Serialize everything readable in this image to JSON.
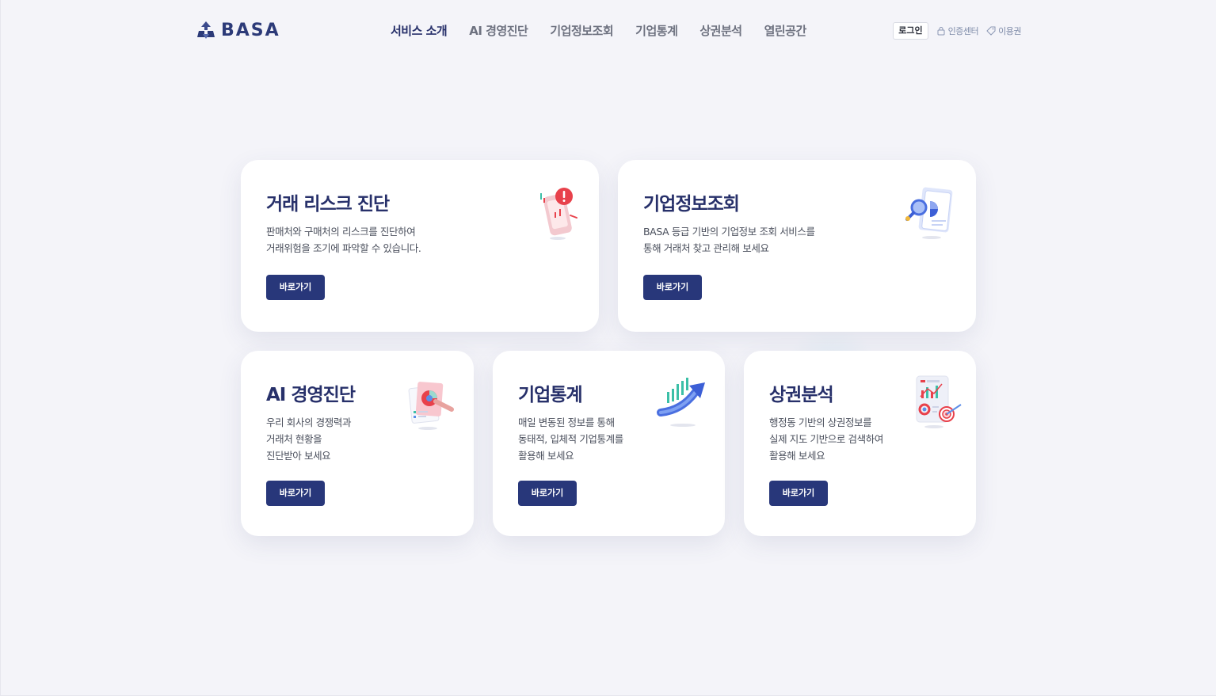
{
  "header": {
    "logo_text": "BASA",
    "nav": [
      {
        "label": "서비스 소개",
        "active": true
      },
      {
        "label": "AI 경영진단",
        "active": false
      },
      {
        "label": "기업정보조회",
        "active": false
      },
      {
        "label": "기업통계",
        "active": false
      },
      {
        "label": "상권분석",
        "active": false
      },
      {
        "label": "열린공간",
        "active": false
      }
    ],
    "login_label": "로그인",
    "cert_label": "인증센터",
    "voucher_label": "이용권"
  },
  "cards": {
    "risk": {
      "title": "거래 리스크 진단",
      "desc": [
        "판매처와 구매처의 리스크를 진단하여",
        "거래위험을 조기에 파악할 수 있습니다."
      ],
      "button": "바로가기",
      "icon": "risk-alert-phone-icon"
    },
    "info": {
      "title": "기업정보조회",
      "desc": [
        "BASA 등급 기반의 기업정보 조회 서비스를",
        "통해 거래처 찾고 관리해 보세요"
      ],
      "button": "바로가기",
      "icon": "document-search-icon"
    },
    "ai": {
      "title": "AI 경영진단",
      "desc": [
        "우리 회사의 경쟁력과",
        "거래처 현황을",
        "진단받아 보세요"
      ],
      "button": "바로가기",
      "icon": "report-chart-icon"
    },
    "stats": {
      "title": "기업통계",
      "desc": [
        "매일 변동된 정보를 통해",
        "동태적, 입체적 기업통계를",
        "활용해 보세요"
      ],
      "button": "바로가기",
      "icon": "growth-arrow-chart-icon"
    },
    "market": {
      "title": "상권분석",
      "desc": [
        "행정동 기반의 상권정보를",
        "실제 지도 기반으로 검색하여",
        "활용해 보세요"
      ],
      "button": "바로가기",
      "icon": "target-dashboard-icon"
    }
  },
  "colors": {
    "primary": "#28377a",
    "title": "#27306a",
    "background": "#f4f4f9",
    "accent_red": "#e8414b",
    "accent_blue": "#4a6fe0"
  }
}
